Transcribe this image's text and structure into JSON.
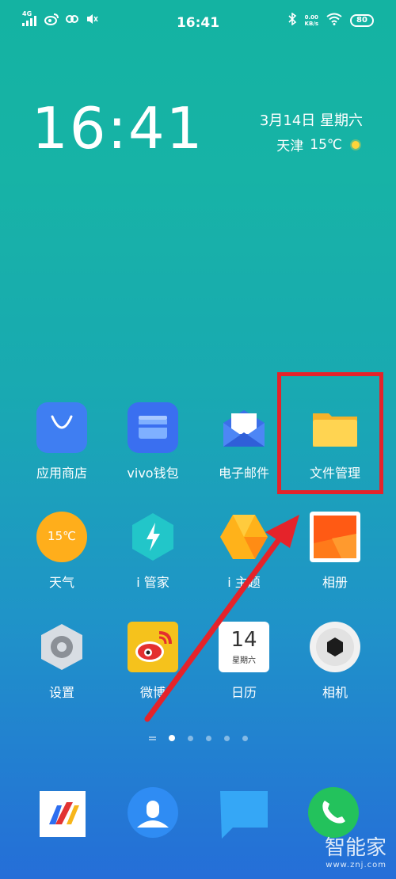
{
  "status_bar": {
    "network": "4G",
    "time": "16:41",
    "speed_value": "0.00",
    "speed_unit": "KB/s",
    "battery": "80"
  },
  "widget": {
    "clock": "16:41",
    "date": "3月14日 星期六",
    "city": "天津",
    "temperature": "15℃"
  },
  "apps": [
    {
      "label": "应用商店"
    },
    {
      "label": "vivo钱包"
    },
    {
      "label": "电子邮件"
    },
    {
      "label": "文件管理"
    },
    {
      "label": "天气",
      "icon_text": "15℃"
    },
    {
      "label": "i 管家"
    },
    {
      "label": "i 主题"
    },
    {
      "label": "相册"
    },
    {
      "label": "设置"
    },
    {
      "label": "微博"
    },
    {
      "label": "日历",
      "icon_day": "14",
      "icon_weekday": "星期六"
    },
    {
      "label": "相机"
    }
  ],
  "dock": [
    {
      "icon": "browser-icon"
    },
    {
      "icon": "contacts-icon"
    },
    {
      "icon": "messages-icon"
    },
    {
      "icon": "phone-icon"
    }
  ],
  "page_indicator": {
    "pages": 5,
    "current": 1
  },
  "watermark": {
    "text": "智能家",
    "url": "www.znj.com"
  },
  "annotation": {
    "highlight_color": "#e5232a",
    "target": "文件管理"
  }
}
